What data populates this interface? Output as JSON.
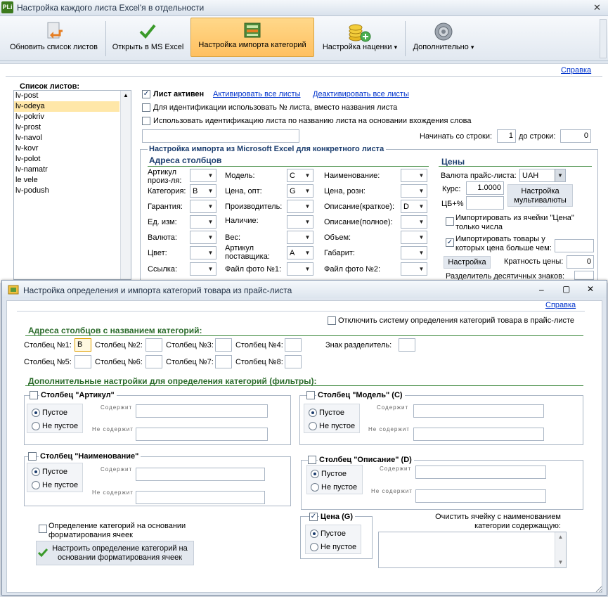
{
  "app": {
    "logo": "PLi",
    "title": "Настройка каждого листа Excel'я в отдельности",
    "close": "✕"
  },
  "toolbar": {
    "refresh": "Обновить список листов",
    "open_excel": "Открыть в MS Excel",
    "import_cat": "Настройка импорта категорий",
    "markup": "Настройка наценки",
    "more": "Дополнительно",
    "arrow": "▾"
  },
  "help": "Справка",
  "sheets": {
    "title": "Список листов:",
    "items": [
      "lv-post",
      "lv-odeya",
      "lv-pokriv",
      "lv-prost",
      "lv-navol",
      "lv-kovr",
      "lv-polot",
      "lv-namatr",
      "le vele",
      "lv-podush"
    ],
    "selected": 1
  },
  "sheet_settings": {
    "active": "Лист активен",
    "activate_all": "Активировать все листы",
    "deactivate_all": "Деактивировать все листы",
    "use_number": "Для идентификации использовать № листа, вместо названия листа",
    "use_name": "Использовать идентификацию листа по названию листа на основании вхождения слова",
    "start_row": "Начинать со строки:",
    "start_val": "1",
    "to_row": "до строки:",
    "to_val": "0"
  },
  "import_group": {
    "title": "Настройка импорта из Microsoft Excel для конкретного листа",
    "addr": "Адреса столбцов"
  },
  "cols": {
    "r1": {
      "a": "Артикул",
      "a2": "произ-ля:",
      "b": "Модель:",
      "bv": "C",
      "c": "Наименование:",
      "cv": ""
    },
    "r2": {
      "a": "Категория:",
      "av": "B",
      "b": "Цена, опт:",
      "bv": "G",
      "c": "Цена, розн:",
      "cv": ""
    },
    "r3": {
      "a": "Гарантия:",
      "b": "Производитель:",
      "c": "Описание(краткое):",
      "cv": "D"
    },
    "r4": {
      "a": "Ед. изм:",
      "b": "Наличие:",
      "c": "Описание(полное):"
    },
    "r5": {
      "a": "Валюта:",
      "b": "Вес:",
      "c": "Объем:"
    },
    "r6": {
      "a": "Цвет:",
      "b": "Артикул",
      "b2": "поставщика:",
      "bv": "A",
      "c": "Габарит:"
    },
    "r7": {
      "a": "Ссылка:",
      "b": "Файл фото №1:",
      "c": "Файл фото №2:"
    }
  },
  "prices": {
    "title": "Цены",
    "currency_label": "Валюта прайс-листа:",
    "currency": "UAH",
    "rate_label": "Курс:",
    "rate": "1.0000",
    "cb_label": "ЦБ+%",
    "multi": "Настройка мультивалюты",
    "only_num_1": "Импортировать из ячейки \"Цена\"",
    "only_num_2": "только числа",
    "greater_1": "Импортировать товары у",
    "greater_2": "которых цена больше чем:",
    "config": "Настройка",
    "mult_label": "Кратность цены:",
    "mult": "0",
    "decimal": "Разделитель десятичных знаков:"
  },
  "dialog": {
    "title": "Настройка определения и импорта категорий товара из прайс-листа",
    "min": "–",
    "max": "▢",
    "close": "✕",
    "help": "Справка",
    "disable": "Отключить систему определения категорий товара в прайс-листе",
    "cat_addr": "Адреса столбцов с названием категорий:",
    "c1": "Столбец №1:",
    "c1v": "B",
    "c2": "Столбец №2:",
    "c3": "Столбец №3:",
    "c4": "Столбец №4:",
    "c5": "Столбец №5:",
    "c6": "Столбец №6:",
    "c7": "Столбец №7:",
    "c8": "Столбец №8:",
    "sep": "Знак разделитель:",
    "filters": "Дополнительные настройки для определения категорий (фильтры):",
    "contains": "Содержит",
    "not_contains": "Не содержит",
    "empty": "Пустое",
    "not_empty": "Не пустое",
    "g_art": "Столбец \"Артикул\"",
    "g_model": "Столбец \"Модель\" (C)",
    "g_name": "Столбец \"Наименование\"",
    "g_desc": "Столбец \"Описание\" (D)",
    "g_price": "Цена (G)",
    "fmt_1": "Определение категорий на основании",
    "fmt_2": "форматирования ячеек",
    "fmt_btn_1": "Настроить определение категорий на",
    "fmt_btn_2": "основании форматирования ячеек",
    "clear_1": "Очистить ячейку с наименованием",
    "clear_2": "категории содержащую:"
  },
  "colors": {
    "accent": "#ffc060",
    "header": "#1b3d6e",
    "green": "#3f8a3f",
    "link": "#0033cc"
  }
}
